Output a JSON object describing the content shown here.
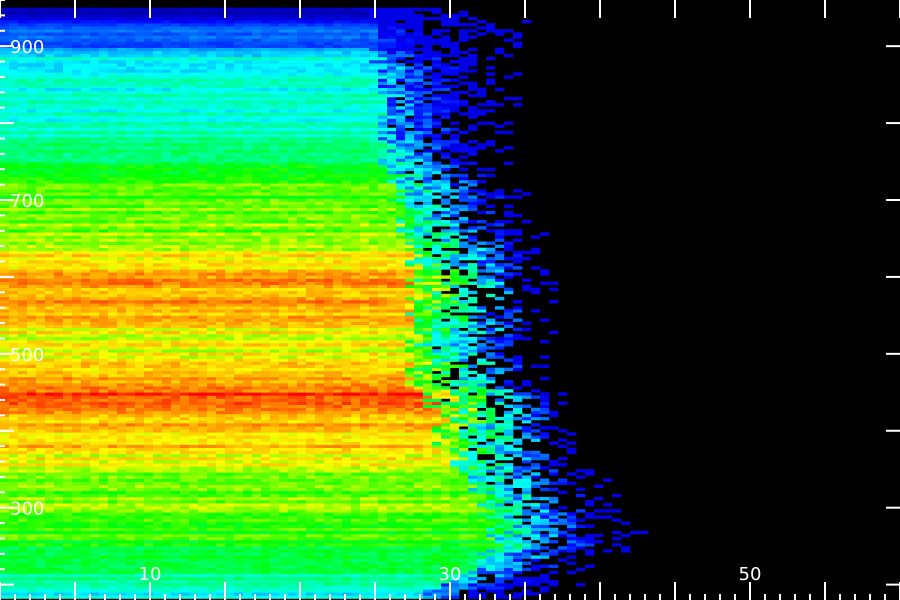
{
  "chart_data": {
    "type": "heatmap",
    "title": "",
    "xlabel": "",
    "ylabel": "",
    "x_ticks": [
      10,
      30,
      50
    ],
    "y_ticks": [
      300,
      500,
      700,
      900
    ],
    "xlim": [
      0,
      60
    ],
    "ylim": [
      180,
      960
    ],
    "colormap": [
      "#000000",
      "#0000ff",
      "#00ffff",
      "#00ff00",
      "#ffff00",
      "#ff8000",
      "#ff0000"
    ],
    "background": "#000000",
    "tick_color": "#ffffff",
    "grid": false,
    "legend": "none",
    "intensity_profile": [
      {
        "y": 190,
        "intensity": 0.35,
        "extent": 31
      },
      {
        "y": 220,
        "intensity": 0.45,
        "extent": 34
      },
      {
        "y": 260,
        "intensity": 0.55,
        "extent": 36
      },
      {
        "y": 300,
        "intensity": 0.58,
        "extent": 35
      },
      {
        "y": 340,
        "intensity": 0.6,
        "extent": 33
      },
      {
        "y": 380,
        "intensity": 0.75,
        "extent": 32
      },
      {
        "y": 420,
        "intensity": 0.8,
        "extent": 32
      },
      {
        "y": 440,
        "intensity": 0.95,
        "extent": 31
      },
      {
        "y": 460,
        "intensity": 0.82,
        "extent": 30
      },
      {
        "y": 500,
        "intensity": 0.68,
        "extent": 30
      },
      {
        "y": 530,
        "intensity": 0.72,
        "extent": 30
      },
      {
        "y": 580,
        "intensity": 0.82,
        "extent": 30
      },
      {
        "y": 600,
        "intensity": 0.78,
        "extent": 30
      },
      {
        "y": 640,
        "intensity": 0.64,
        "extent": 30
      },
      {
        "y": 680,
        "intensity": 0.58,
        "extent": 29
      },
      {
        "y": 720,
        "intensity": 0.55,
        "extent": 29
      },
      {
        "y": 760,
        "intensity": 0.45,
        "extent": 28
      },
      {
        "y": 800,
        "intensity": 0.38,
        "extent": 28
      },
      {
        "y": 840,
        "intensity": 0.37,
        "extent": 28
      },
      {
        "y": 880,
        "intensity": 0.36,
        "extent": 28
      },
      {
        "y": 900,
        "intensity": 0.22,
        "extent": 28
      },
      {
        "y": 920,
        "intensity": 0.25,
        "extent": 28
      },
      {
        "y": 940,
        "intensity": 0.12,
        "extent": 27
      }
    ]
  }
}
